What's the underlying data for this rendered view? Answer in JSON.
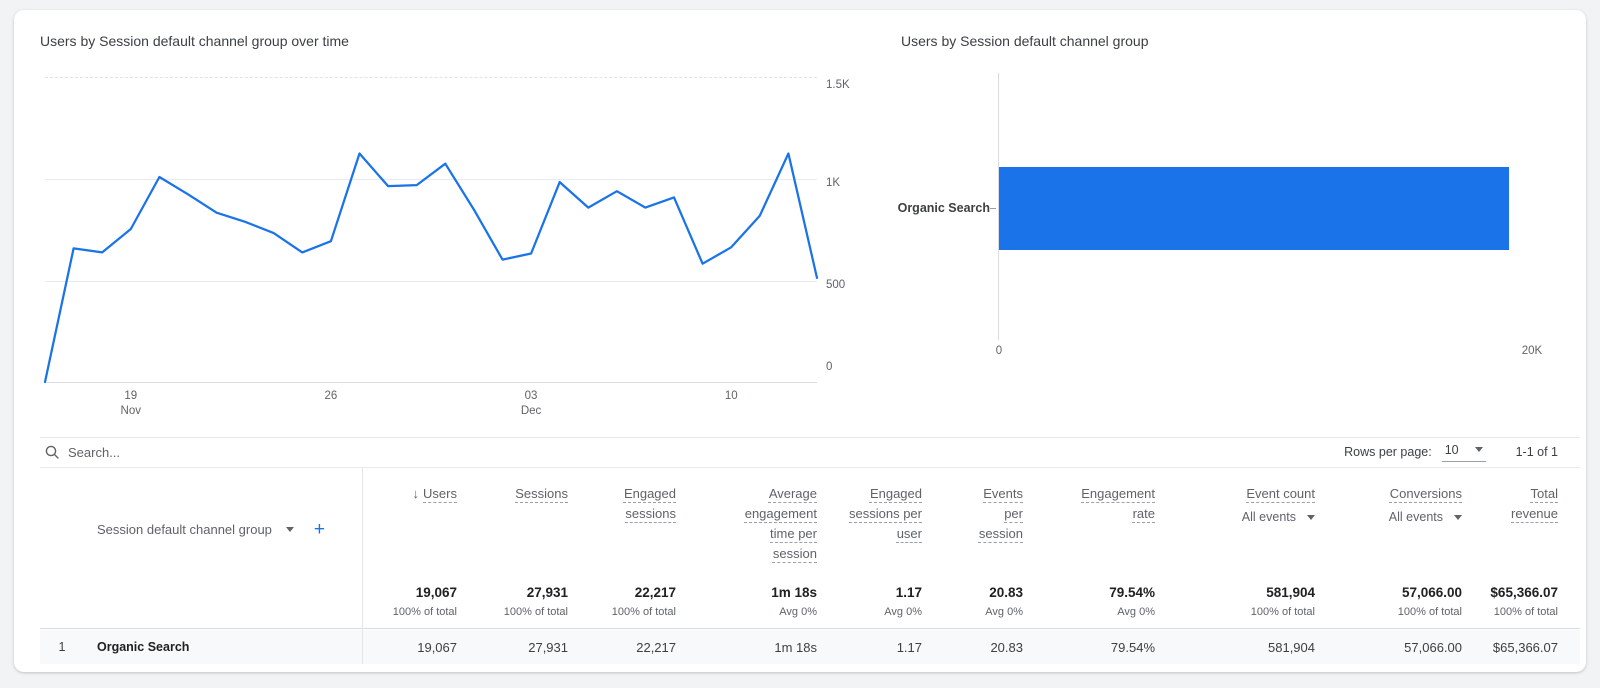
{
  "chart_data": [
    {
      "type": "line",
      "title": "Users by Session default channel group over time",
      "x": [
        "Nov 16",
        "Nov 17",
        "Nov 18",
        "Nov 19",
        "Nov 20",
        "Nov 21",
        "Nov 22",
        "Nov 23",
        "Nov 24",
        "Nov 25",
        "Nov 26",
        "Nov 27",
        "Nov 28",
        "Nov 29",
        "Nov 30",
        "Dec 01",
        "Dec 02",
        "Dec 03",
        "Dec 04",
        "Dec 05",
        "Dec 06",
        "Dec 07",
        "Dec 08",
        "Dec 09",
        "Dec 10",
        "Dec 11",
        "Dec 12",
        "Dec 13"
      ],
      "series": [
        {
          "name": "Users",
          "values": [
            5,
            660,
            640,
            755,
            1010,
            925,
            835,
            790,
            735,
            640,
            695,
            1125,
            965,
            970,
            1075,
            850,
            605,
            635,
            985,
            860,
            940,
            860,
            910,
            585,
            665,
            820,
            1125,
            515
          ]
        }
      ],
      "ylim": [
        0,
        1500
      ],
      "y_ticks": [
        {
          "label": "1.5K",
          "value": 1500
        },
        {
          "label": "1K",
          "value": 1000
        },
        {
          "label": "500",
          "value": 500
        },
        {
          "label": "0",
          "value": 0
        }
      ],
      "x_ticks": [
        {
          "index": 3,
          "label": "19",
          "sublabel": "Nov"
        },
        {
          "index": 10,
          "label": "26",
          "sublabel": ""
        },
        {
          "index": 17,
          "label": "03",
          "sublabel": "Dec"
        },
        {
          "index": 24,
          "label": "10",
          "sublabel": ""
        }
      ],
      "grid": "horizontal",
      "legend": "none",
      "line_color": "#1a73e8"
    },
    {
      "type": "bar",
      "orientation": "horizontal",
      "title": "Users by Session default channel group",
      "categories": [
        "Organic Search"
      ],
      "values": [
        19067
      ],
      "xlim": [
        0,
        20000
      ],
      "x_tick_labels": [
        "0",
        "20K"
      ],
      "bar_color": "#1a73e8"
    }
  ],
  "toolbar": {
    "search_placeholder": "Search...",
    "rows_per_page_label": "Rows per page:",
    "rows_per_page_value": "10",
    "range_label": "1-1 of 1"
  },
  "table": {
    "dimension_header": "Session default channel group",
    "columns": [
      {
        "label": "Users",
        "sorted": true
      },
      {
        "label": "Sessions"
      },
      {
        "label": "Engaged sessions"
      },
      {
        "label": "Average engagement time per session"
      },
      {
        "label": "Engaged sessions per user"
      },
      {
        "label": "Events per session"
      },
      {
        "label": "Engagement rate"
      },
      {
        "label": "Event count",
        "filter": "All events"
      },
      {
        "label": "Conversions",
        "filter": "All events"
      },
      {
        "label": "Total revenue"
      }
    ],
    "totals": [
      {
        "value": "19,067",
        "sub": "100% of total"
      },
      {
        "value": "27,931",
        "sub": "100% of total"
      },
      {
        "value": "22,217",
        "sub": "100% of total"
      },
      {
        "value": "1m 18s",
        "sub": "Avg 0%"
      },
      {
        "value": "1.17",
        "sub": "Avg 0%"
      },
      {
        "value": "20.83",
        "sub": "Avg 0%"
      },
      {
        "value": "79.54%",
        "sub": "Avg 0%"
      },
      {
        "value": "581,904",
        "sub": "100% of total"
      },
      {
        "value": "57,066.00",
        "sub": "100% of total"
      },
      {
        "value": "$65,366.07",
        "sub": "100% of total"
      }
    ],
    "rows": [
      {
        "num": "1",
        "dimension": "Organic Search",
        "values": [
          "19,067",
          "27,931",
          "22,217",
          "1m 18s",
          "1.17",
          "20.83",
          "79.54%",
          "581,904",
          "57,066.00",
          "$65,366.07"
        ]
      }
    ]
  },
  "colors": {
    "accent": "#1a73e8"
  }
}
